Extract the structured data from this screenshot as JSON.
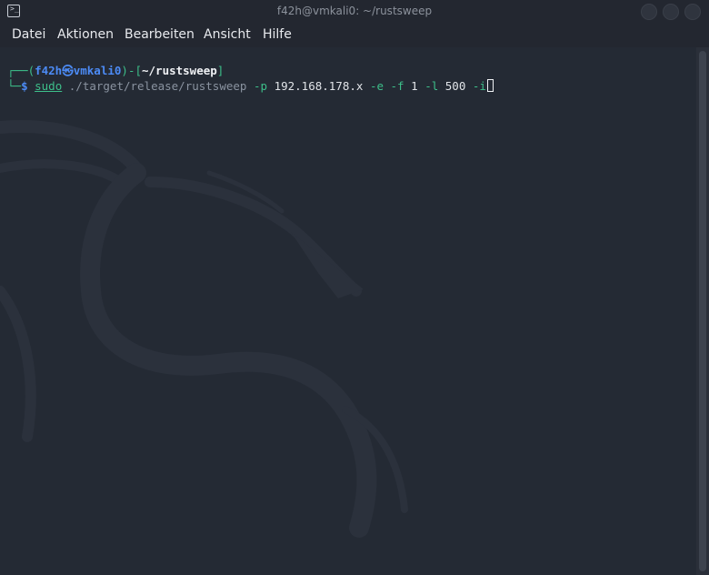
{
  "window": {
    "title": "f42h@vmkali0: ~/rustsweep"
  },
  "menu": {
    "items": [
      "Datei",
      "Aktionen",
      "Bearbeiten",
      "Ansicht",
      "Hilfe"
    ]
  },
  "prompt": {
    "corner_top": "┌──(",
    "user": "f42h",
    "at": "㉿",
    "host": "vmkali0",
    "sep": ")-[",
    "dir": "~/rustsweep",
    "close": "]",
    "corner_bottom": "└─",
    "dollar": "$"
  },
  "command": {
    "name": "sudo",
    "binary": "./target/release/rustsweep",
    "flag_p": "-p",
    "ip": "192.168.178.x",
    "flag_e": "-e",
    "flag_f": "-f",
    "f_value": "1",
    "flag_l": "-l",
    "l_value": "500",
    "flag_i": "-i"
  },
  "colors": {
    "background": "#242a34",
    "accent_green": "#3dbf8a",
    "accent_blue": "#4c8bf5"
  }
}
